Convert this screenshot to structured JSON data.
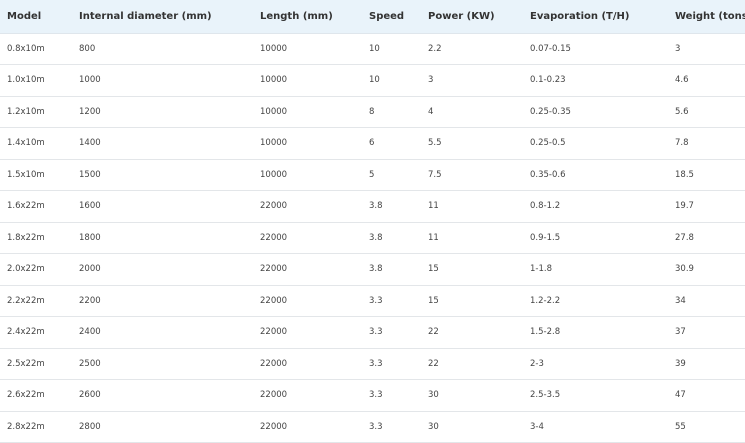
{
  "table": {
    "headers": [
      "Model",
      "Internal diameter (mm)",
      "Length (mm)",
      "Speed",
      "Power (KW)",
      "Evaporation (T/H)",
      "Weight (tons)"
    ],
    "rows": [
      [
        "0.8x10m",
        "800",
        "10000",
        "10",
        "2.2",
        "0.07-0.15",
        "3"
      ],
      [
        "1.0x10m",
        "1000",
        "10000",
        "10",
        "3",
        "0.1-0.23",
        "4.6"
      ],
      [
        "1.2x10m",
        "1200",
        "10000",
        "8",
        "4",
        "0.25-0.35",
        "5.6"
      ],
      [
        "1.4x10m",
        "1400",
        "10000",
        "6",
        "5.5",
        "0.25-0.5",
        "7.8"
      ],
      [
        "1.5x10m",
        "1500",
        "10000",
        "5",
        "7.5",
        "0.35-0.6",
        "18.5"
      ],
      [
        "1.6x22m",
        "1600",
        "22000",
        "3.8",
        "11",
        "0.8-1.2",
        "19.7"
      ],
      [
        "1.8x22m",
        "1800",
        "22000",
        "3.8",
        "11",
        "0.9-1.5",
        "27.8"
      ],
      [
        "2.0x22m",
        "2000",
        "22000",
        "3.8",
        "15",
        "1-1.8",
        "30.9"
      ],
      [
        "2.2x22m",
        "2200",
        "22000",
        "3.3",
        "15",
        "1.2-2.2",
        "34"
      ],
      [
        "2.4x22m",
        "2400",
        "22000",
        "3.3",
        "22",
        "1.5-2.8",
        "37"
      ],
      [
        "2.5x22m",
        "2500",
        "22000",
        "3.3",
        "22",
        "2-3",
        "39"
      ],
      [
        "2.6x22m",
        "2600",
        "22000",
        "3.3",
        "30",
        "2.5-3.5",
        "47"
      ],
      [
        "2.8x22m",
        "2800",
        "22000",
        "3.3",
        "30",
        "3-4",
        "55"
      ]
    ]
  }
}
